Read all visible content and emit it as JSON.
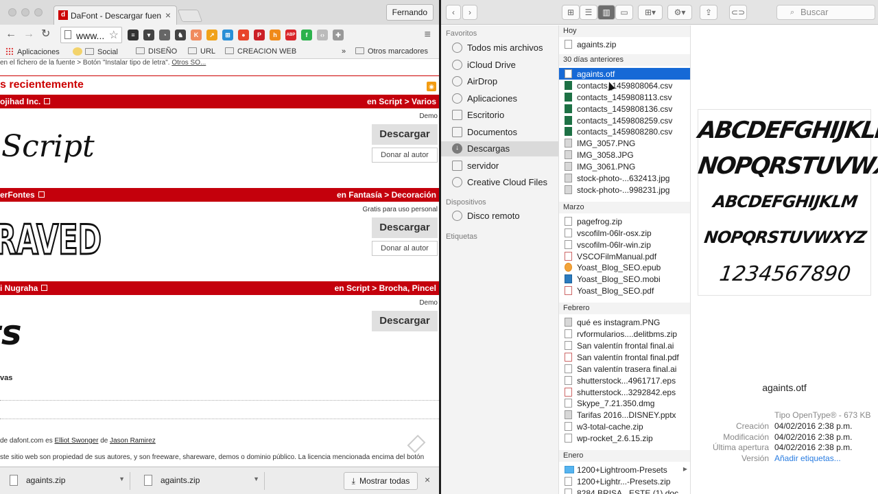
{
  "chrome": {
    "tab_title": "DaFont - Descargar fuentes",
    "tab_favicon": "d",
    "profile_name": "Fernando",
    "url": "www...",
    "bookmarks": [
      "Aplicaciones",
      "Social",
      "DISEÑO",
      "URL",
      "CREACION WEB",
      "»",
      "Otros marcadores"
    ],
    "extensions": [
      {
        "name": "buffer-icon",
        "color": "#333333",
        "glyph": "≡"
      },
      {
        "name": "pocket-icon",
        "color": "#444444",
        "glyph": "▾"
      },
      {
        "name": "clock-icon",
        "color": "#666666",
        "glyph": "◔"
      },
      {
        "name": "owl-icon",
        "color": "#444444",
        "glyph": "♞"
      },
      {
        "name": "kred-icon",
        "color": "#f08a5d",
        "glyph": "K"
      },
      {
        "name": "chart-icon",
        "color": "#f0a21a",
        "glyph": "↗"
      },
      {
        "name": "tab-icon",
        "color": "#2a8fd6",
        "glyph": "⊞"
      },
      {
        "name": "stop-icon",
        "color": "#e8452b",
        "glyph": "●"
      },
      {
        "name": "pinterest-icon",
        "color": "#cb2027",
        "glyph": "P"
      },
      {
        "name": "hootsuite-icon",
        "color": "#f08a1a",
        "glyph": "h"
      },
      {
        "name": "adblock-icon",
        "color": "#d9252a",
        "glyph": "ABP"
      },
      {
        "name": "feedly-icon",
        "color": "#2bb24c",
        "glyph": "f"
      },
      {
        "name": "code-icon",
        "color": "#bbbbbb",
        "glyph": "‹›"
      },
      {
        "name": "puzzle-icon",
        "color": "#999999",
        "glyph": "✚"
      }
    ]
  },
  "page": {
    "instructions": "en el fichero de la fuente > Botón \"Instalar tipo de letra\". ",
    "instructions_link": "Otros SO...",
    "section_title": "s recientemente",
    "fonts": [
      {
        "author": "ojihad Inc.",
        "category": "en Script > Varios",
        "license": "Demo",
        "preview": "Script",
        "download": "Descargar",
        "donate": "Donar al autor"
      },
      {
        "author": "erFontes",
        "category": "en Fantasía > Decoración",
        "license": "Gratis para uso personal",
        "preview": "RAVED",
        "download": "Descargar",
        "donate": "Donar al autor"
      },
      {
        "author": "i Nugraha",
        "category": "en Script > Brocha, Pincel",
        "license": "Demo",
        "preview": "ts",
        "download": "Descargar",
        "donate": ""
      }
    ],
    "new_label": "vas",
    "credits_prefix": "de dafont.com es ",
    "credits_a": "Elliot Swonger",
    "credits_mid": " de ",
    "credits_b": "Jason Ramirez",
    "disclaimer": "ste sitio web son propiedad de sus autores, y son freeware, shareware, demos o dominio público. La licencia mencionada encima del botón"
  },
  "downloads_bar": {
    "items": [
      "againts.zip",
      "againts.zip"
    ],
    "show_all": "Mostrar todas",
    "close": "×"
  },
  "finder": {
    "search_placeholder": "Buscar",
    "sidebar": {
      "favorites_header": "Favoritos",
      "favorites": [
        "Todos mis archivos",
        "iCloud Drive",
        "AirDrop",
        "Aplicaciones",
        "Escritorio",
        "Documentos",
        "Descargas",
        "servidor",
        "Creative Cloud Files"
      ],
      "selected_favorite": "Descargas",
      "devices_header": "Dispositivos",
      "devices": [
        "Disco remoto"
      ],
      "tags_header": "Etiquetas"
    },
    "groups": [
      {
        "label": "Hoy",
        "files": [
          {
            "name": "againts.zip",
            "kind": "zip"
          }
        ]
      },
      {
        "label": "30 días anteriores",
        "files": [
          {
            "name": "againts.otf",
            "kind": "doc",
            "selected": true
          },
          {
            "name": "contacts_1459808064.csv",
            "kind": "xl"
          },
          {
            "name": "contacts_1459808113.csv",
            "kind": "xl"
          },
          {
            "name": "contacts_1459808136.csv",
            "kind": "xl"
          },
          {
            "name": "contacts_1459808259.csv",
            "kind": "xl"
          },
          {
            "name": "contacts_1459808280.csv",
            "kind": "xl"
          },
          {
            "name": "IMG_3057.PNG",
            "kind": "img"
          },
          {
            "name": "IMG_3058.JPG",
            "kind": "img"
          },
          {
            "name": "IMG_3061.PNG",
            "kind": "img"
          },
          {
            "name": "stock-photo-...632413.jpg",
            "kind": "img"
          },
          {
            "name": "stock-photo-...998231.jpg",
            "kind": "img"
          }
        ]
      },
      {
        "label": "Marzo",
        "files": [
          {
            "name": "pagefrog.zip",
            "kind": "zip"
          },
          {
            "name": "vscofilm-06lr-osx.zip",
            "kind": "zip"
          },
          {
            "name": "vscofilm-06lr-win.zip",
            "kind": "zip"
          },
          {
            "name": "VSCOFilmManual.pdf",
            "kind": "pdf"
          },
          {
            "name": "Yoast_Blog_SEO.epub",
            "kind": "epub"
          },
          {
            "name": "Yoast_Blog_SEO.mobi",
            "kind": "mobi"
          },
          {
            "name": "Yoast_Blog_SEO.pdf",
            "kind": "pdf"
          }
        ]
      },
      {
        "label": "Febrero",
        "files": [
          {
            "name": "qué es instagram.PNG",
            "kind": "img"
          },
          {
            "name": "rvformularios....delitbms.zip",
            "kind": "zip"
          },
          {
            "name": "San valentín frontal final.ai",
            "kind": "doc"
          },
          {
            "name": "San valentín frontal final.pdf",
            "kind": "pdf"
          },
          {
            "name": "San valentín trasera final.ai",
            "kind": "doc"
          },
          {
            "name": "shutterstock...4961717.eps",
            "kind": "doc"
          },
          {
            "name": "shutterstock...3292842.eps",
            "kind": "pdf"
          },
          {
            "name": "Skype_7.21.350.dmg",
            "kind": "doc"
          },
          {
            "name": "Tarifas 2016...DISNEY.pptx",
            "kind": "img"
          },
          {
            "name": "w3-total-cache.zip",
            "kind": "zip"
          },
          {
            "name": "wp-rocket_2.6.15.zip",
            "kind": "zip"
          }
        ]
      },
      {
        "label": "Enero",
        "files": [
          {
            "name": "1200+Lightroom-Presets",
            "kind": "dir",
            "folder": true
          },
          {
            "name": "1200+Lightr...-Presets.zip",
            "kind": "zip"
          },
          {
            "name": "8284 BRISA...ESTE (1).doc",
            "kind": "doc"
          }
        ]
      }
    ],
    "preview": {
      "glyph_lines": [
        "ABCDEFGHIJKLM",
        "NOPQRSTUVWXYZ",
        "ABCDEFGHIJKLM",
        "NOPQRSTUVWXYZ",
        "1234567890"
      ],
      "filename": "againts.otf",
      "meta": [
        {
          "key": "",
          "value": "Tipo OpenType® - 673 KB",
          "muted": true
        },
        {
          "key": "Creación",
          "value": "04/02/2016 2:38 p.m."
        },
        {
          "key": "Modificación",
          "value": "04/02/2016 2:38 p.m."
        },
        {
          "key": "Última apertura",
          "value": "04/02/2016 2:38 p.m."
        },
        {
          "key": "Versión",
          "value": "Añadir etiquetas...",
          "link": true
        }
      ]
    }
  }
}
